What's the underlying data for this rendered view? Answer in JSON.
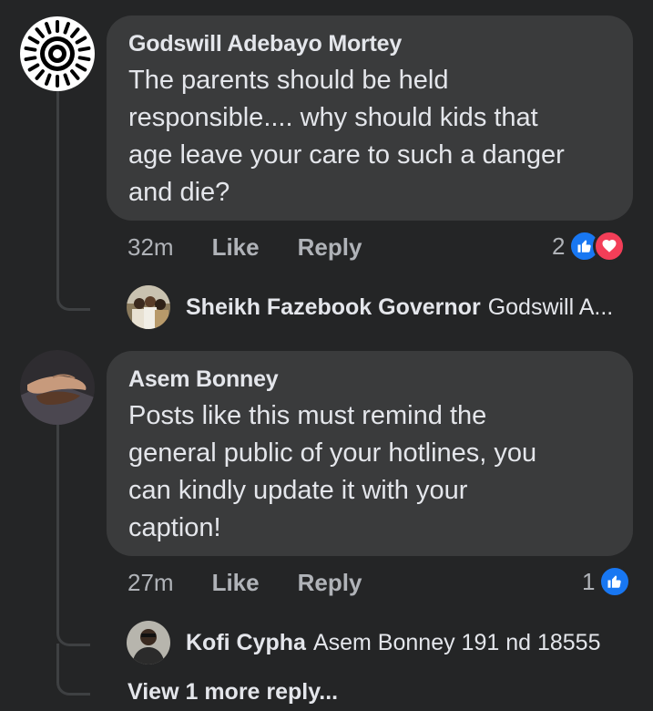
{
  "comments": [
    {
      "author": "Godswill Adebayo Mortey",
      "text": "The parents should be held\nresponsible.... why should kids that\nage leave your care to such a danger\nand die?",
      "time": "32m",
      "like_label": "Like",
      "reply_label": "Reply",
      "reaction_count": "2",
      "reactions": [
        "like-icon",
        "love-icon"
      ],
      "reply_preview": {
        "author": "Sheikh Fazebook Governor",
        "text": "Godswill A..."
      }
    },
    {
      "author": "Asem Bonney",
      "text": "Posts like this must remind the\ngeneral public of your hotlines, you\ncan kindly update it with your\ncaption!",
      "time": "27m",
      "like_label": "Like",
      "reply_label": "Reply",
      "reaction_count": "1",
      "reactions": [
        "like-icon"
      ],
      "reply_preview": {
        "author": "Kofi Cypha",
        "text": "Asem Bonney 191 nd 18555"
      },
      "view_more_label": "View 1 more reply..."
    }
  ],
  "colors": {
    "background": "#242526",
    "bubble": "#3a3b3c",
    "text_primary": "#e4e6eb",
    "text_secondary": "#b0b3b8",
    "like_blue": "#1877f2",
    "love_red": "#f33e58"
  }
}
